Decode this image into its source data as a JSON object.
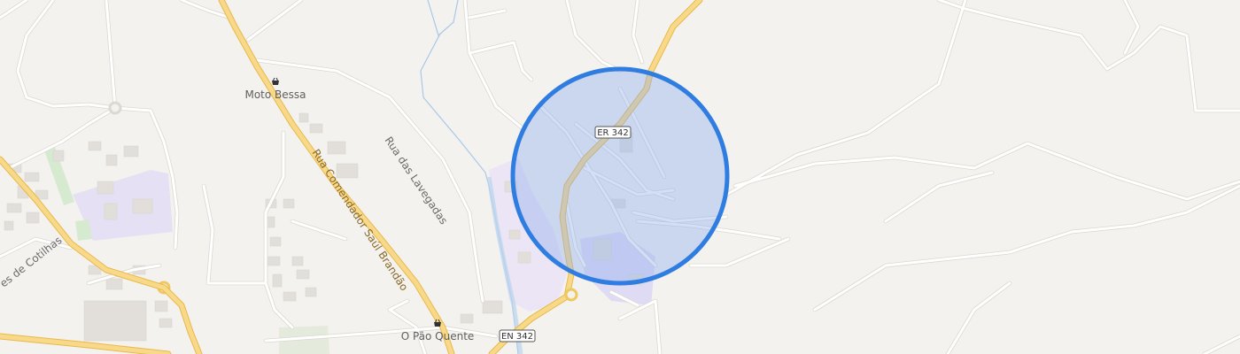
{
  "map": {
    "poi": {
      "moto_bessa": "Moto Bessa",
      "pao_quente": "O Pão Quente"
    },
    "streets": {
      "comendador": "Rua Comendador Saúl Brandão",
      "lavegadas": "Rua das Lavegadas",
      "cotilhas": "es de Cotilhas"
    },
    "routes": {
      "er342": "ER 342",
      "en342": "EN 342"
    },
    "icons": {
      "shop": "shopping-basket-icon",
      "location": "location-accuracy-circle"
    },
    "colors": {
      "background": "#f4f2ee",
      "major_road": "#f5d27a",
      "accuracy_fill": "#8fb0ee",
      "accuracy_stroke": "#2f7de1",
      "water": "#a8c8e8",
      "landuse_purple": "#e6e0f4",
      "landuse_green": "#d6ead0"
    }
  }
}
